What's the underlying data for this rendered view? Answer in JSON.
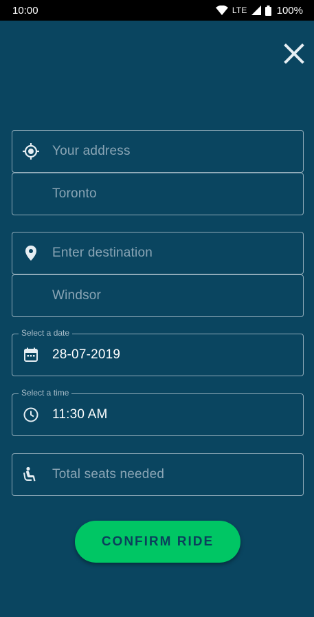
{
  "status_bar": {
    "time": "10:00",
    "network": "LTE",
    "battery": "100%"
  },
  "form": {
    "pickup": {
      "placeholder": "Your address",
      "city": "Toronto"
    },
    "destination": {
      "placeholder": "Enter destination",
      "city": "Windsor"
    },
    "date": {
      "label": "Select a date",
      "value": "28-07-2019"
    },
    "time": {
      "label": "Select a time",
      "value": "11:30 AM"
    },
    "seats": {
      "placeholder": "Total seats needed"
    }
  },
  "confirm_button": {
    "label": "CONFIRM RIDE"
  },
  "icons": {
    "close": "close-icon",
    "pickup": "gps-fixed-icon",
    "destination": "location-pin-icon",
    "date": "calendar-icon",
    "time": "clock-icon",
    "seats": "seat-icon"
  },
  "colors": {
    "background": "#0a4560",
    "accent": "#00c664",
    "button_text": "#0b3f5c"
  }
}
